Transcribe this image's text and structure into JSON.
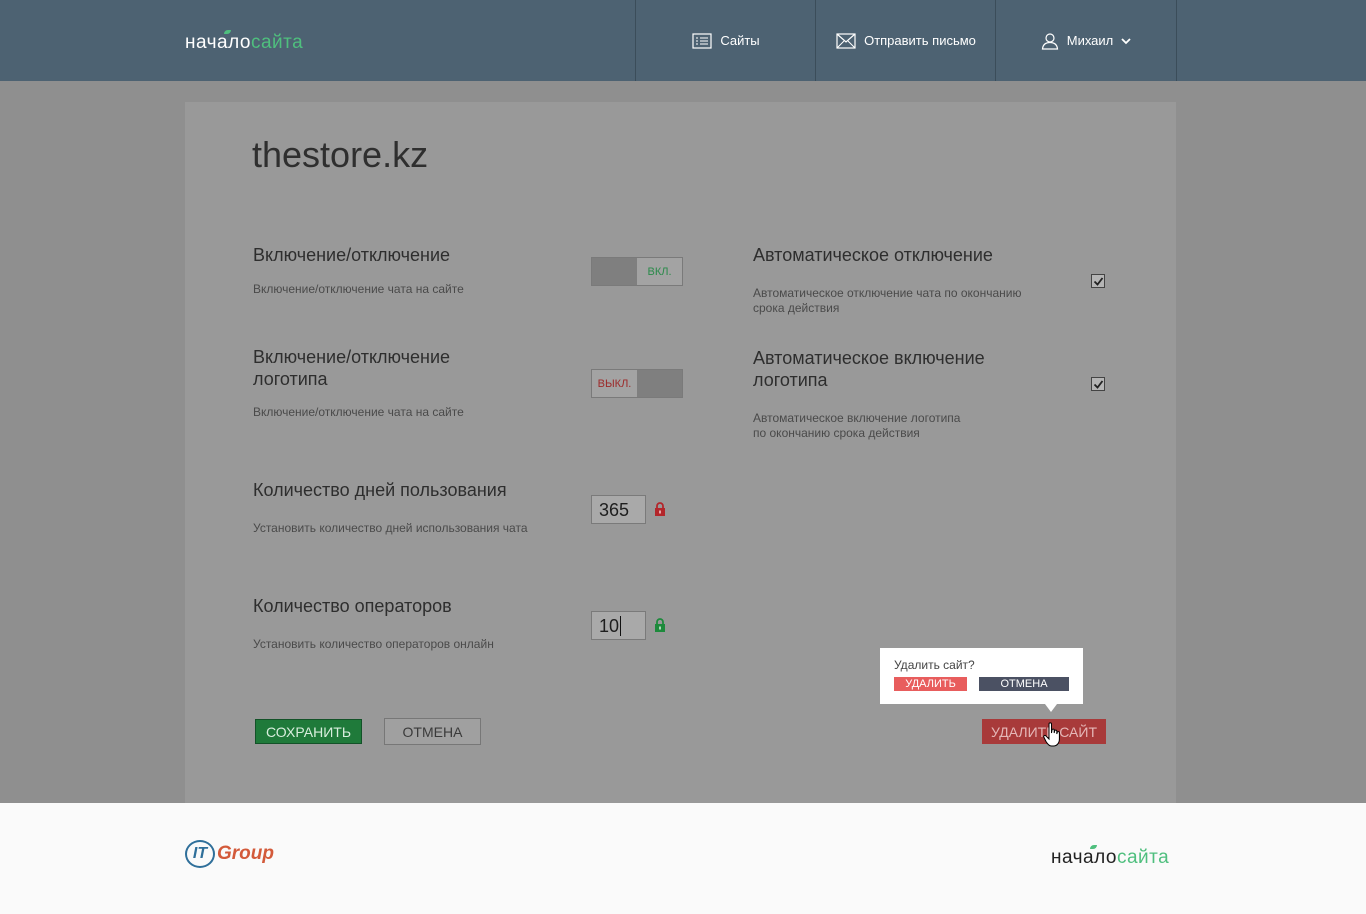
{
  "header": {
    "logo_part1": "начало",
    "logo_part2": "сайта",
    "nav": [
      {
        "label": "Сайты",
        "icon": "list-icon"
      },
      {
        "label": "Отправить письмо",
        "icon": "envelope-icon"
      },
      {
        "label": "Михаил",
        "icon": "user-icon"
      }
    ]
  },
  "site": {
    "title": "thestore.kz"
  },
  "settings": {
    "enable": {
      "label": "Включение/отключение",
      "desc": "Включение/отключение чата на сайте",
      "state": "ВКЛ."
    },
    "logo": {
      "label": "Включение/отключение логотипа",
      "desc": "Включение/отключение чата на сайте",
      "state": "ВЫКЛ."
    },
    "days": {
      "label": "Количество дней пользования",
      "desc": "Установить количество дней использования чата",
      "value": "365",
      "locked": true
    },
    "operators": {
      "label": "Количество операторов",
      "desc": "Установить количество операторов онлайн",
      "value": "10",
      "locked": false
    },
    "auto_off": {
      "label": "Автоматическое отключение",
      "desc": "Автоматическое отключение чата по окончанию срока действия",
      "checked": true
    },
    "auto_logo": {
      "label": "Автоматическое включение логотипа",
      "desc": "Автоматическое включение логотипа по окончанию срока действия",
      "checked": true
    }
  },
  "actions": {
    "save": "СОХРАНИТЬ",
    "cancel": "ОТМЕНА",
    "delete_site": "УДАЛИТЬ САЙТ"
  },
  "popup": {
    "question": "Удалить сайт?",
    "delete": "УДАЛИТЬ",
    "cancel": "ОТМЕНА"
  },
  "footer": {
    "it_logo_a": "IT",
    "it_logo_b": "Group",
    "logo_part1": "начало",
    "logo_part2": "сайта"
  },
  "colors": {
    "header": "#4d6272",
    "accent_green": "#4fbf7e",
    "save": "#1f7a3a",
    "delete": "#a83a3a"
  }
}
